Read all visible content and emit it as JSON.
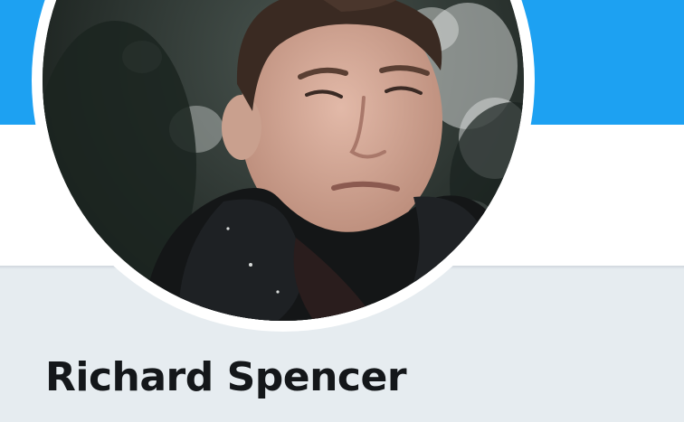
{
  "profile": {
    "display_name": "Richard Spencer",
    "avatar_icon": "profile-photo-avatar"
  },
  "colors": {
    "banner": "#1da1f2",
    "nav_background": "#ffffff",
    "page_background": "#e6ecf0",
    "name_text": "#14171a"
  }
}
